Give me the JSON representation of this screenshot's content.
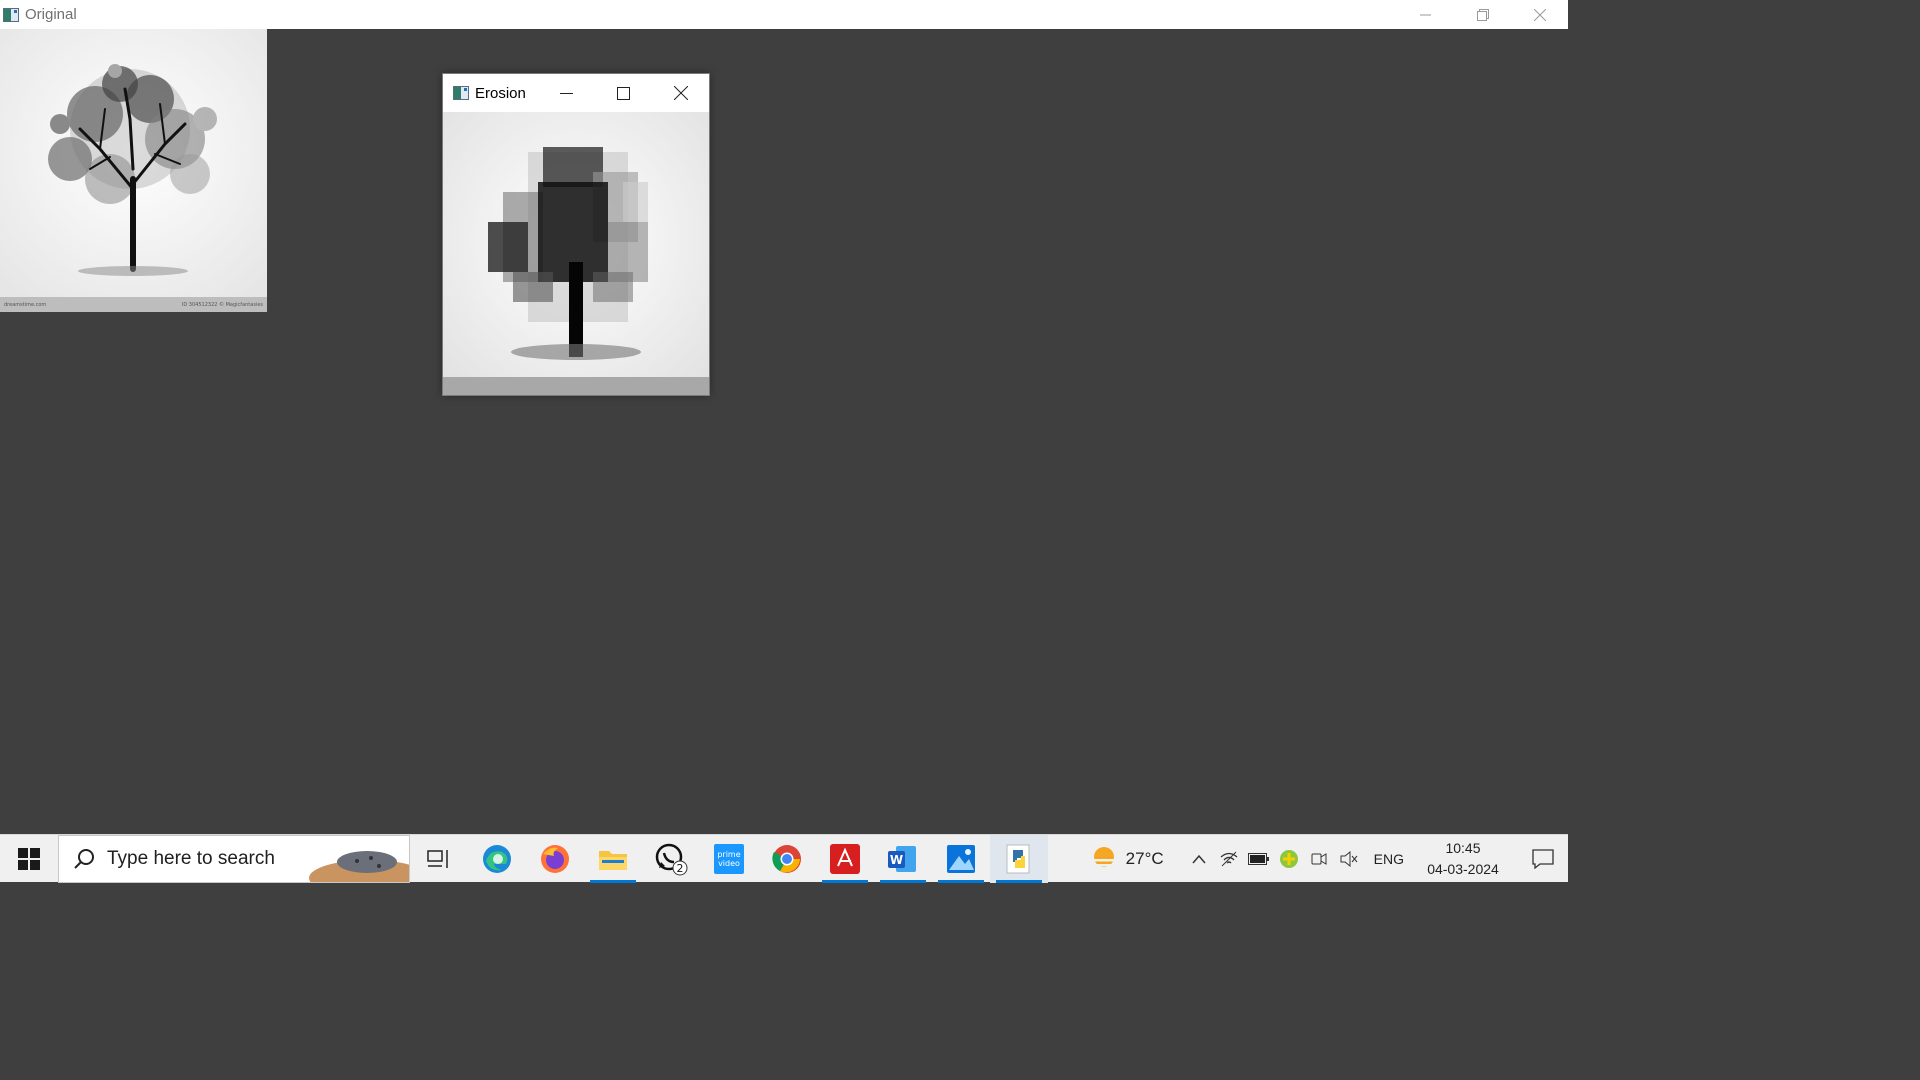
{
  "main_window": {
    "title": "Original",
    "controls": {
      "minimize": "—",
      "restore": "❐",
      "close": "✕"
    },
    "image_footer": {
      "left": "dreamstime.com",
      "right": "ID 304512322 © Magicfantasies"
    }
  },
  "erosion_window": {
    "title": "Erosion",
    "controls": {
      "minimize": "—",
      "maximize": "☐",
      "close": "✕"
    }
  },
  "taskbar": {
    "search_placeholder": "Type here to search",
    "apps": [
      {
        "name": "task-view",
        "active": false
      },
      {
        "name": "edge",
        "active": false
      },
      {
        "name": "firefox",
        "active": false
      },
      {
        "name": "file-explorer",
        "active": true
      },
      {
        "name": "whatsapp",
        "active": false,
        "badge": "2"
      },
      {
        "name": "prime-video",
        "active": false
      },
      {
        "name": "chrome",
        "active": false
      },
      {
        "name": "acrobat",
        "active": true
      },
      {
        "name": "word",
        "active": true
      },
      {
        "name": "photos",
        "active": true
      },
      {
        "name": "python",
        "active": true
      }
    ],
    "prime_label": "prime video",
    "weather_temp": "27°C",
    "language": "ENG",
    "time": "10:45",
    "date": "04-03-2024"
  },
  "colors": {
    "desktop_bg": "#3f3f3f",
    "taskbar_bg": "#f0f0f0",
    "accent": "#0078d7"
  }
}
